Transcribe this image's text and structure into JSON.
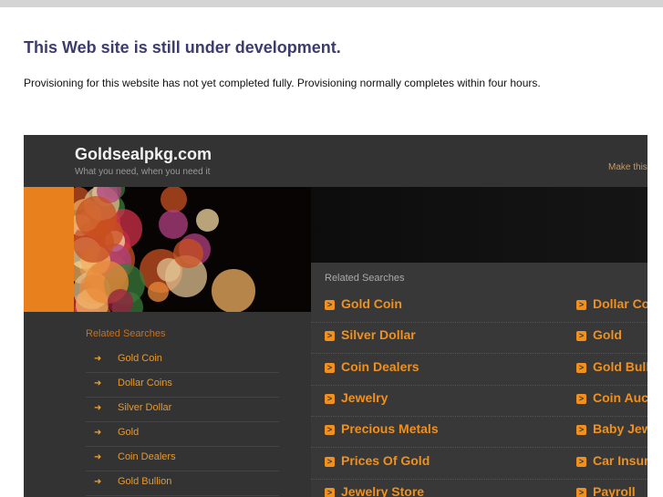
{
  "notice": {
    "title": "This Web site is still under development.",
    "message": "Provisioning for this website has not yet completed fully. Provisioning normally completes within four hours."
  },
  "site": {
    "name": "Goldsealpkg.com",
    "tagline": "What you need, when you need it",
    "make_homepage": "Make this"
  },
  "search": {
    "icon": "magnifier-icon"
  },
  "main_related": {
    "title": "Related Searches",
    "col1": [
      "Gold Coin",
      "Silver Dollar",
      "Coin Dealers",
      "Jewelry",
      "Precious Metals",
      "Prices Of Gold",
      "Jewelry Store"
    ],
    "col2": [
      "Dollar Co",
      "Gold",
      "Gold Bull",
      "Coin Auc",
      "Baby Jew",
      "Car Insur",
      "Payroll"
    ]
  },
  "side_related": {
    "title": "Related Searches",
    "items": [
      "Gold Coin",
      "Dollar Coins",
      "Silver Dollar",
      "Gold",
      "Coin Dealers",
      "Gold Bullion"
    ]
  },
  "colors": {
    "accent": "#f0901e",
    "frame": "#333333"
  }
}
